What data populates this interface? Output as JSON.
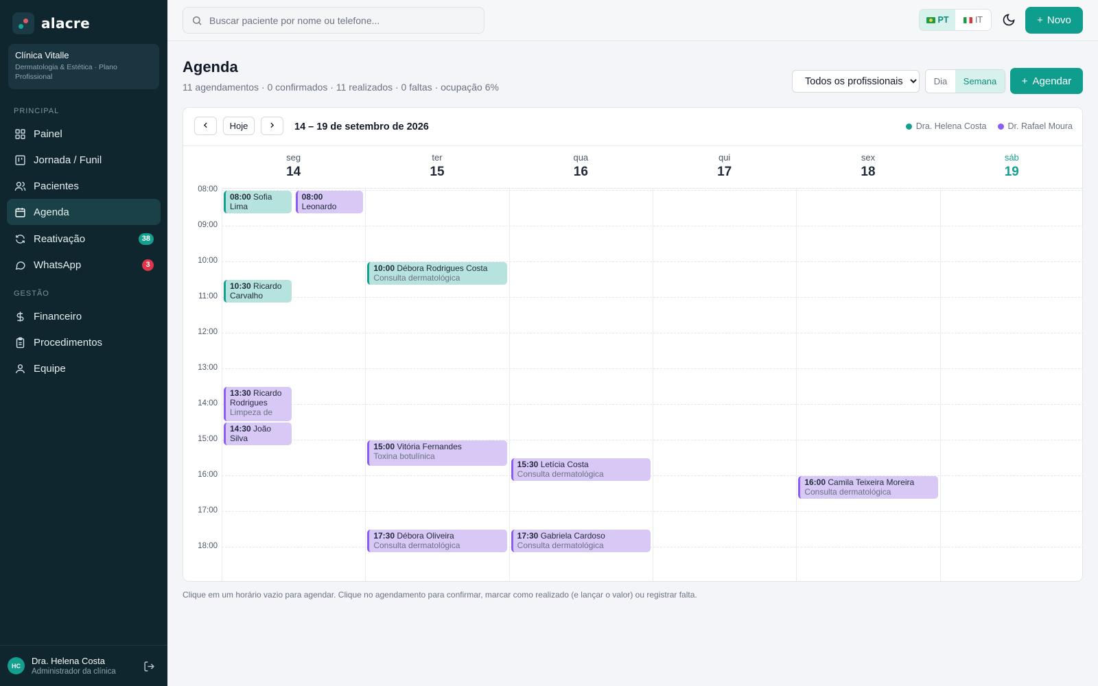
{
  "app": {
    "brand": "alacre"
  },
  "clinic": {
    "name": "Clínica Vitalle",
    "subtitle": "Dermatologia & Estética · Plano Profissional"
  },
  "sidebar": {
    "section_principal": "PRINCIPAL",
    "section_gestao": "GESTÃO",
    "items": [
      {
        "label": "Painel",
        "icon": "grid-icon"
      },
      {
        "label": "Jornada / Funil",
        "icon": "kanban-icon"
      },
      {
        "label": "Pacientes",
        "icon": "users-icon"
      },
      {
        "label": "Agenda",
        "icon": "calendar-icon",
        "active": true
      },
      {
        "label": "Reativação",
        "icon": "refresh-icon",
        "badge": "38"
      },
      {
        "label": "WhatsApp",
        "icon": "chat-icon",
        "badge": "3"
      },
      {
        "label": "Financeiro",
        "icon": "dollar-icon"
      },
      {
        "label": "Procedimentos",
        "icon": "clipboard-icon"
      },
      {
        "label": "Equipe",
        "icon": "user-icon"
      }
    ]
  },
  "user": {
    "initials": "HC",
    "name": "Dra. Helena Costa",
    "role": "Administrador da clínica"
  },
  "topbar": {
    "search_placeholder": "Buscar paciente por nome ou telefone...",
    "lang_pt": "PT",
    "lang_it": "IT",
    "new_label": "Novo"
  },
  "page": {
    "title": "Agenda",
    "summary": "11 agendamentos · 0 confirmados · 11 realizados · 0 faltas · ocupação 6%",
    "professional_filter": "Todos os profissionais",
    "view_day": "Dia",
    "view_week": "Semana",
    "schedule_label": "Agendar"
  },
  "calendar": {
    "today_label": "Hoje",
    "range": "14 – 19 de setembro de 2026",
    "legend": [
      {
        "name": "Dra. Helena Costa",
        "color": "#14a08f"
      },
      {
        "name": "Dr. Rafael Moura",
        "color": "#8b5cf6"
      }
    ],
    "days": [
      {
        "name": "seg",
        "num": "14"
      },
      {
        "name": "ter",
        "num": "15"
      },
      {
        "name": "qua",
        "num": "16"
      },
      {
        "name": "qui",
        "num": "17"
      },
      {
        "name": "sex",
        "num": "18"
      },
      {
        "name": "sáb",
        "num": "19",
        "today": true
      }
    ],
    "hours": [
      "08:00",
      "09:00",
      "10:00",
      "11:00",
      "12:00",
      "13:00",
      "14:00",
      "15:00",
      "16:00",
      "17:00",
      "18:00"
    ],
    "appointments": [
      {
        "day": 0,
        "start": "08:00",
        "end": "08:40",
        "lane": 0,
        "time": "08:00",
        "patient": "Sofia Lima",
        "procedure": "",
        "prof": "helena"
      },
      {
        "day": 0,
        "start": "08:00",
        "end": "08:40",
        "lane": 1,
        "time": "08:00",
        "patient": "Leonardo",
        "procedure": "",
        "prof": "rafael"
      },
      {
        "day": 1,
        "start": "10:00",
        "end": "10:40",
        "lane": -1,
        "time": "10:00",
        "patient": "Débora Rodrigues Costa",
        "procedure": "Consulta dermatológica",
        "prof": "helena"
      },
      {
        "day": 0,
        "start": "10:30",
        "end": "11:10",
        "lane": 0,
        "time": "10:30",
        "patient": "Ricardo Carvalho",
        "procedure": "",
        "prof": "helena"
      },
      {
        "day": 0,
        "start": "13:30",
        "end": "14:30",
        "lane": 0,
        "time": "13:30",
        "patient": "Ricardo Rodrigues",
        "procedure": "Limpeza de",
        "prof": "rafael"
      },
      {
        "day": 0,
        "start": "14:30",
        "end": "15:10",
        "lane": 0,
        "time": "14:30",
        "patient": "João Silva",
        "procedure": "",
        "prof": "rafael"
      },
      {
        "day": 1,
        "start": "15:00",
        "end": "15:45",
        "lane": -1,
        "time": "15:00",
        "patient": "Vitória Fernandes",
        "procedure": "Toxina botulínica",
        "prof": "rafael"
      },
      {
        "day": 2,
        "start": "15:30",
        "end": "16:10",
        "lane": -1,
        "time": "15:30",
        "patient": "Letícia Costa",
        "procedure": "Consulta dermatológica",
        "prof": "rafael"
      },
      {
        "day": 4,
        "start": "16:00",
        "end": "16:40",
        "lane": -1,
        "time": "16:00",
        "patient": "Camila Teixeira Moreira",
        "procedure": "Consulta dermatológica",
        "prof": "rafael"
      },
      {
        "day": 1,
        "start": "17:30",
        "end": "18:10",
        "lane": -1,
        "time": "17:30",
        "patient": "Débora Oliveira",
        "procedure": "Consulta dermatológica",
        "prof": "rafael"
      },
      {
        "day": 2,
        "start": "17:30",
        "end": "18:10",
        "lane": -1,
        "time": "17:30",
        "patient": "Gabriela Cardoso",
        "procedure": "Consulta dermatológica",
        "prof": "rafael"
      }
    ]
  },
  "footer_note": "Clique em um horário vazio para agendar. Clique no agendamento para confirmar, marcar como realizado (e lançar o valor) ou registrar falta."
}
